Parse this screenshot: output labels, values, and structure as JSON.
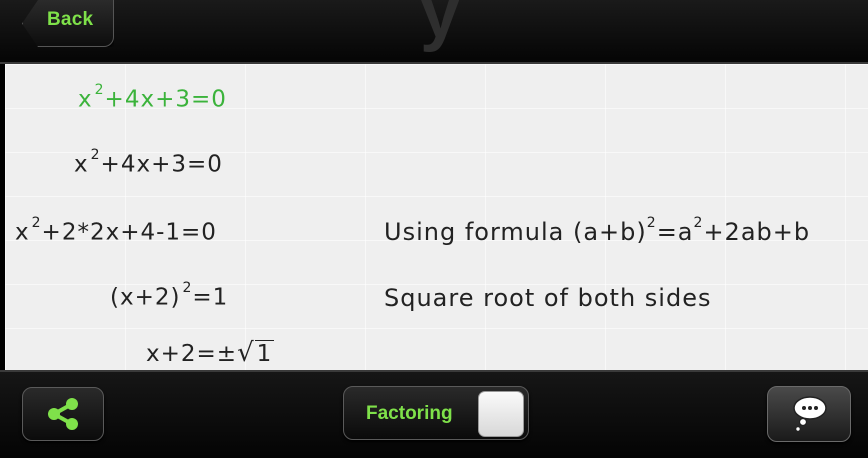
{
  "header": {
    "logo_letter": "y",
    "back_label": "Back"
  },
  "steps": [
    {
      "lhs_base": "x",
      "exp": "2",
      "rest": "+4x+3=0",
      "note": ""
    },
    {
      "lhs_base": "x",
      "exp": "2",
      "rest": "+4x+3=0",
      "note": ""
    },
    {
      "lhs_base": "x",
      "exp": "2",
      "rest": "+2*2x+4-1=0",
      "note_pre": "Using formula (a+b)",
      "note_exp1": "2",
      "note_mid": "=a",
      "note_exp2": "2",
      "note_post": "+2ab+b"
    },
    {
      "lhs_base": "(x+2)",
      "exp": "2",
      "rest": "=1",
      "note": "Square root of both sides"
    },
    {
      "lhs": "x+2=±",
      "sqrt_arg": "1"
    }
  ],
  "toolbar": {
    "mode_label": "Factoring",
    "toggle_on": true
  },
  "colors": {
    "accent_green": "#7fe14a",
    "equation_green": "#3bb33b"
  },
  "icons": {
    "share": "share-icon",
    "hint": "thought-bubble-icon"
  }
}
